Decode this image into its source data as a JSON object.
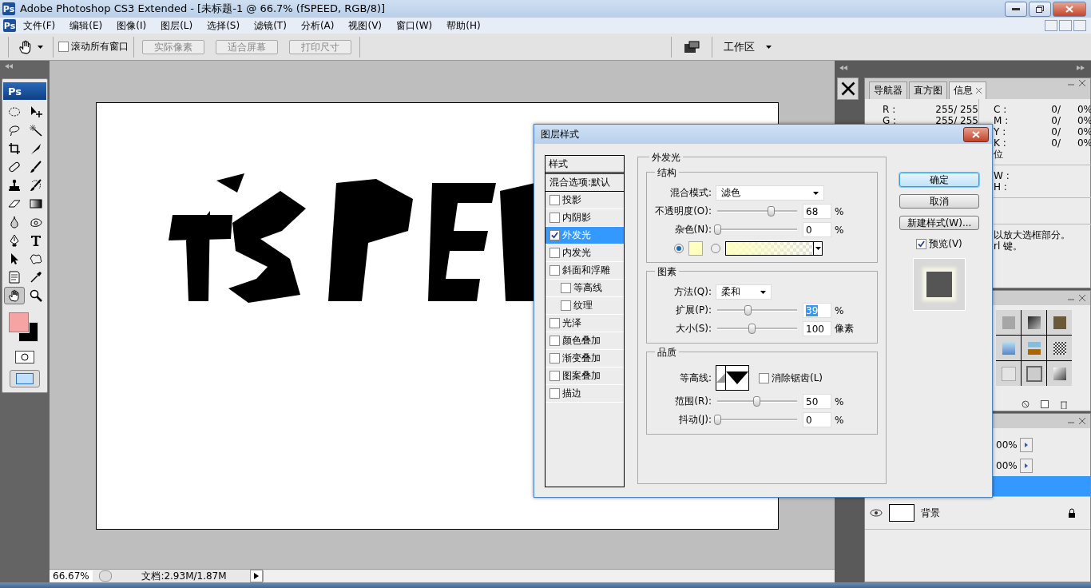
{
  "window": {
    "icon": "Ps",
    "title": "Adobe Photoshop CS3 Extended - [未标题-1 @ 66.7% (fSPEED, RGB/8)]",
    "menu_icon": "Ps"
  },
  "menu": [
    "文件(F)",
    "编辑(E)",
    "图像(I)",
    "图层(L)",
    "选择(S)",
    "滤镜(T)",
    "分析(A)",
    "视图(V)",
    "窗口(W)",
    "帮助(H)"
  ],
  "options_bar": {
    "scroll_all": {
      "label": "滚动所有窗口",
      "checked": false
    },
    "buttons": [
      {
        "label": "实际像素",
        "disabled": true
      },
      {
        "label": "适合屏幕",
        "disabled": true
      },
      {
        "label": "打印尺寸",
        "disabled": true
      }
    ],
    "workspace": "工作区"
  },
  "toolbox": {
    "logo": "Ps",
    "tools": [
      {
        "kind": "marquee",
        "selected": false
      },
      {
        "kind": "move",
        "selected": false
      },
      {
        "kind": "lasso",
        "selected": false
      },
      {
        "kind": "wand",
        "selected": false
      },
      {
        "kind": "crop",
        "selected": false
      },
      {
        "kind": "slice",
        "selected": false
      },
      {
        "kind": "heal",
        "selected": false
      },
      {
        "kind": "brush",
        "selected": false
      },
      {
        "kind": "stamp",
        "selected": false
      },
      {
        "kind": "history",
        "selected": false
      },
      {
        "kind": "eraser",
        "selected": false
      },
      {
        "kind": "gradient",
        "selected": false
      },
      {
        "kind": "blur",
        "selected": false
      },
      {
        "kind": "dodge",
        "selected": false
      },
      {
        "kind": "pen",
        "selected": false
      },
      {
        "kind": "type",
        "selected": false
      },
      {
        "kind": "select",
        "selected": false
      },
      {
        "kind": "shape",
        "selected": false
      },
      {
        "kind": "notes",
        "selected": false
      },
      {
        "kind": "eyedropper",
        "selected": false
      },
      {
        "kind": "hand",
        "selected": true
      },
      {
        "kind": "zoom",
        "selected": false
      }
    ],
    "colors": [
      {
        "kind": "foreground",
        "color": "#f5a3a3"
      },
      {
        "kind": "background",
        "color": "#000000"
      }
    ]
  },
  "info_panel": {
    "tabs": [
      {
        "label": "导航器",
        "selected": false
      },
      {
        "label": "直方图",
        "selected": false
      },
      {
        "label": "信息",
        "selected": true
      }
    ],
    "rgb_rows": [
      {
        "label": "R :",
        "value": "255/  255"
      },
      {
        "label": "G :",
        "value": "255/  255"
      }
    ],
    "cmyk_rows": [
      {
        "label": "C :",
        "value": "0/",
        "percent": "0%"
      },
      {
        "label": "M :",
        "value": "0/",
        "percent": "0%"
      },
      {
        "label": "Y :",
        "value": "0/",
        "percent": "0%"
      },
      {
        "label": "K :",
        "value": "0/",
        "percent": "0%"
      }
    ],
    "bit_depth": "位",
    "size_rows": [
      "W :",
      "H :"
    ],
    "hint_lines": [
      "以放大选框部分。",
      "rl 键。"
    ]
  },
  "layers_panel": {
    "opacity": "00%",
    "fill": "00%",
    "layers": [
      {
        "selected": true
      },
      {
        "name": "背景",
        "selected": false,
        "visible": true,
        "locked": true
      }
    ]
  },
  "dialog": {
    "title": "图层样式",
    "styles_header": "样式",
    "blending": "混合选项:默认",
    "effects": [
      {
        "label": "投影",
        "checked": false,
        "selected": false
      },
      {
        "label": "内阴影",
        "checked": false,
        "selected": false
      },
      {
        "label": "外发光",
        "checked": true,
        "selected": true
      },
      {
        "label": "内发光",
        "checked": false,
        "selected": false
      },
      {
        "label": "斜面和浮雕",
        "checked": false,
        "selected": false,
        "children": [
          {
            "label": "等高线",
            "checked": false,
            "selected": false
          },
          {
            "label": "纹理",
            "checked": false,
            "selected": false
          }
        ]
      },
      {
        "label": "光泽",
        "checked": false,
        "selected": false
      },
      {
        "label": "颜色叠加",
        "checked": false,
        "selected": false
      },
      {
        "label": "渐变叠加",
        "checked": false,
        "selected": false
      },
      {
        "label": "图案叠加",
        "checked": false,
        "selected": false
      },
      {
        "label": "描边",
        "checked": false,
        "selected": false
      }
    ],
    "section_title": "外发光",
    "structure": {
      "title": "结构",
      "blend_mode": {
        "label": "混合模式:",
        "value": "滤色"
      },
      "sliders": [
        {
          "label": "不透明度(O):",
          "level": 0.67,
          "value": "68",
          "unit": "%",
          "highlighted": false
        },
        {
          "label": "杂色(N):",
          "level": 0,
          "value": "0",
          "unit": "%",
          "highlighted": false
        }
      ],
      "color_source": [
        {
          "kind": "color",
          "selected": true,
          "color": "#ffffc0"
        },
        {
          "kind": "gradient",
          "selected": false
        }
      ]
    },
    "elements": {
      "title": "图素",
      "technique": {
        "label": "方法(Q):",
        "value": "柔和"
      },
      "sliders": [
        {
          "label": "扩展(P):",
          "level": 0.38,
          "value": "39",
          "unit": "%",
          "highlighted": true
        },
        {
          "label": "大小(S):",
          "level": 0.43,
          "value": "100",
          "unit": "像素",
          "highlighted": false
        }
      ]
    },
    "quality": {
      "title": "品质",
      "contour_label": "等高线:",
      "anti_alias": {
        "label": "消除锯齿(L)",
        "checked": false
      },
      "sliders": [
        {
          "label": "范围(R):",
          "level": 0.49,
          "value": "50",
          "unit": "%",
          "highlighted": false
        },
        {
          "label": "抖动(J):",
          "level": 0,
          "value": "0",
          "unit": "%",
          "highlighted": false
        }
      ]
    },
    "buttons": [
      {
        "label": "确定",
        "default": true
      },
      {
        "label": "取消",
        "default": false
      },
      {
        "label": "新建样式(W)...",
        "default": false
      }
    ],
    "preview": {
      "label": "预览(V)",
      "checked": true
    }
  },
  "status_bar": {
    "zoom": "66.67%",
    "doc": "文档:2.93M/1.87M"
  }
}
